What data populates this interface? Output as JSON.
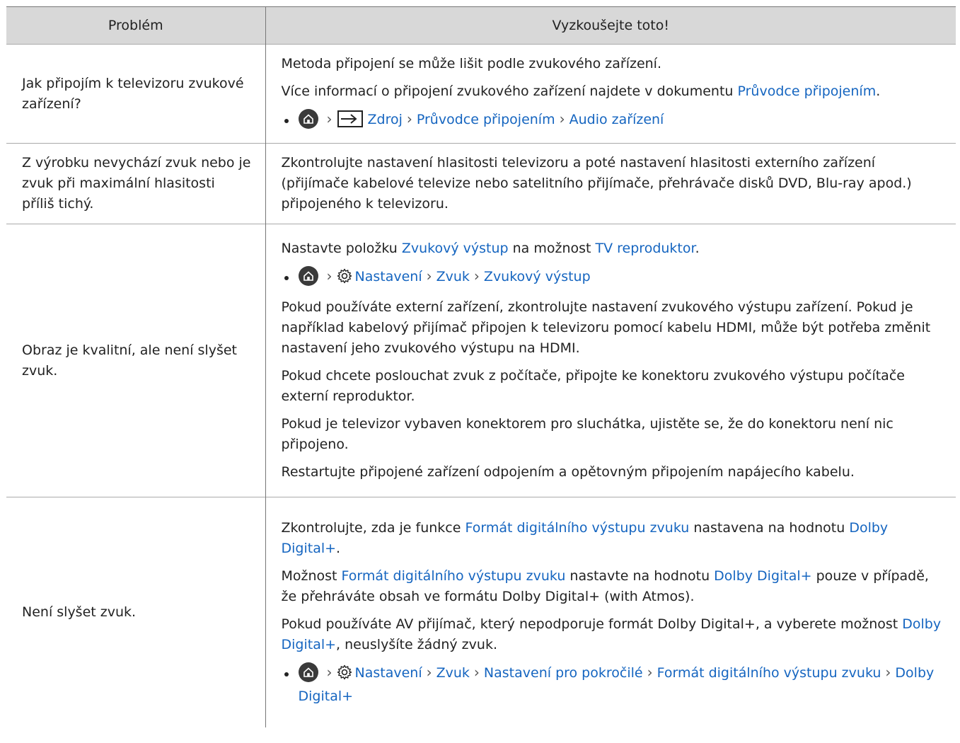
{
  "header": {
    "problem": "Problém",
    "solution": "Vyzkoušejte toto!"
  },
  "rows": [
    {
      "problem": "Jak připojím k televizoru zvukové zařízení?",
      "p1": "Metoda připojení se může lišit podle zvukového zařízení.",
      "p2_text": "Více informací o připojení zvukového zařízení najdete v dokumentu ",
      "p2_link": "Průvodce připojením",
      "p2_end": ".",
      "path": [
        "Zdroj",
        "Průvodce připojením",
        "Audio zařízení"
      ]
    },
    {
      "problem": "Z výrobku nevychází zvuk nebo je zvuk při maximální hlasitosti příliš tichý.",
      "p1": "Zkontrolujte nastavení hlasitosti televizoru a poté nastavení hlasitosti externího zařízení (přijímače kabelové televize nebo satelitního přijímače, přehrávače disků DVD, Blu-ray apod.) připojeného k televizoru."
    },
    {
      "problem": "Obraz je kvalitní, ale není slyšet zvuk.",
      "p1_a": "Nastavte položku ",
      "p1_link1": "Zvukový výstup",
      "p1_b": " na možnost ",
      "p1_link2": "TV reproduktor",
      "p1_c": ".",
      "path": [
        "Nastavení",
        "Zvuk",
        "Zvukový výstup"
      ],
      "p2": "Pokud používáte externí zařízení, zkontrolujte nastavení zvukového výstupu zařízení. Pokud je například kabelový přijímač připojen k televizoru pomocí kabelu HDMI, může být potřeba změnit nastavení jeho zvukového výstupu na HDMI.",
      "p3": "Pokud chcete poslouchat zvuk z počítače, připojte ke konektoru zvukového výstupu počítače externí reproduktor.",
      "p4": "Pokud je televizor vybaven konektorem pro sluchátka, ujistěte se, že do konektoru není nic připojeno.",
      "p5": "Restartujte připojené zařízení odpojením a opětovným připojením napájecího kabelu."
    },
    {
      "problem": "Není slyšet zvuk.",
      "p1_a": "Zkontrolujte, zda je funkce ",
      "p1_link1": "Formát digitálního výstupu zvuku",
      "p1_b": " nastavena na hodnotu ",
      "p1_link2": "Dolby Digital+",
      "p1_c": ".",
      "p2_a": "Možnost ",
      "p2_link1": "Formát digitálního výstupu zvuku",
      "p2_b": " nastavte na hodnotu ",
      "p2_link2": "Dolby Digital+",
      "p2_c": " pouze v případě, že přehráváte obsah ve formátu Dolby Digital+ (with Atmos).",
      "p3_a": "Pokud používáte AV přijímač, který nepodporuje formát Dolby Digital+, a vyberete možnost ",
      "p3_link": "Dolby Digital+",
      "p3_b": ", neuslyšíte žádný zvuk.",
      "path": [
        "Nastavení",
        "Zvuk",
        "Nastavení pro pokročilé",
        "Formát digitálního výstupu zvuku",
        "Dolby Digital+"
      ]
    }
  ],
  "icons": {
    "home": "home-icon",
    "source": "source-icon",
    "settings": "gear-icon",
    "chevron": "chevron-right-icon"
  },
  "colors": {
    "link": "#1565c0",
    "header_bg": "#d8d8d8"
  }
}
